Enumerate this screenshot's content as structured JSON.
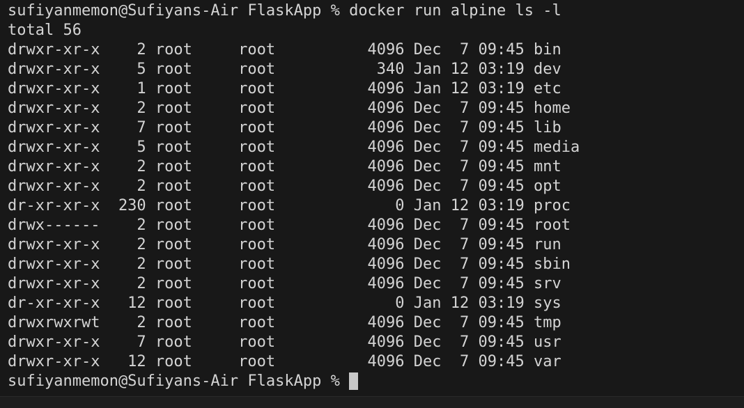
{
  "terminal": {
    "command_line": "sufiyanmemon@Sufiyans-Air FlaskApp % docker run alpine ls -l",
    "total_line": "total 56",
    "entries": [
      "drwxr-xr-x    2 root     root          4096 Dec  7 09:45 bin",
      "drwxr-xr-x    5 root     root           340 Jan 12 03:19 dev",
      "drwxr-xr-x    1 root     root          4096 Jan 12 03:19 etc",
      "drwxr-xr-x    2 root     root          4096 Dec  7 09:45 home",
      "drwxr-xr-x    7 root     root          4096 Dec  7 09:45 lib",
      "drwxr-xr-x    5 root     root          4096 Dec  7 09:45 media",
      "drwxr-xr-x    2 root     root          4096 Dec  7 09:45 mnt",
      "drwxr-xr-x    2 root     root          4096 Dec  7 09:45 opt",
      "dr-xr-xr-x  230 root     root             0 Jan 12 03:19 proc",
      "drwx------    2 root     root          4096 Dec  7 09:45 root",
      "drwxr-xr-x    2 root     root          4096 Dec  7 09:45 run",
      "drwxr-xr-x    2 root     root          4096 Dec  7 09:45 sbin",
      "drwxr-xr-x    2 root     root          4096 Dec  7 09:45 srv",
      "dr-xr-xr-x   12 root     root             0 Jan 12 03:19 sys",
      "drwxrwxrwt    2 root     root          4096 Dec  7 09:45 tmp",
      "drwxr-xr-x    7 root     root          4096 Dec  7 09:45 usr",
      "drwxr-xr-x   12 root     root          4096 Dec  7 09:45 var"
    ],
    "prompt": "sufiyanmemon@Sufiyans-Air FlaskApp % ",
    "colors": {
      "background": "#181818",
      "foreground": "#d4d4d4",
      "cursor": "#c8c8c8"
    }
  }
}
